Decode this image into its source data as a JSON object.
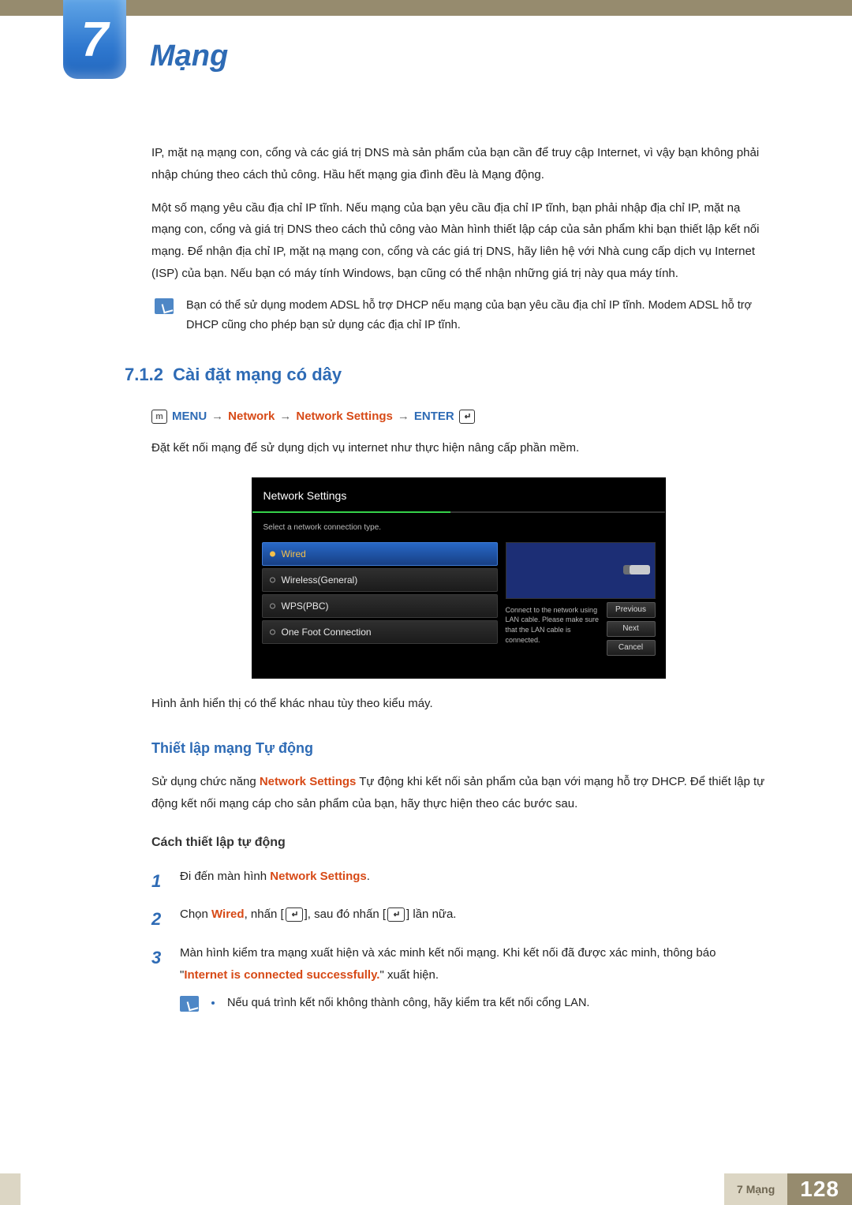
{
  "chapter": {
    "number": "7",
    "title": "Mạng"
  },
  "body": {
    "p1": "IP, mặt nạ mạng con, cổng và các giá trị DNS mà sản phẩm của bạn cần để truy cập Internet, vì vậy bạn không phải nhập chúng theo cách thủ công. Hầu hết mạng gia đình đều là Mạng động.",
    "p2": "Một số mạng yêu cầu địa chỉ IP tĩnh. Nếu mạng của bạn yêu cầu địa chỉ IP tĩnh, bạn phải nhập địa chỉ IP, mặt nạ mạng con, cổng và giá trị DNS theo cách thủ công vào Màn hình thiết lập cáp của sản phẩm khi bạn thiết lập kết nối mạng. Để nhận địa chỉ IP, mặt nạ mạng con, cổng và các giá trị DNS, hãy liên hệ với Nhà cung cấp dịch vụ Internet (ISP) của bạn. Nếu bạn có máy tính Windows, bạn cũng có thể nhận những giá trị này qua máy tính.",
    "note1": "Bạn có thể sử dụng modem ADSL hỗ trợ DHCP nếu mạng của bạn yêu cầu địa chỉ IP tĩnh. Modem ADSL hỗ trợ DHCP cũng cho phép bạn sử dụng các địa chỉ IP tĩnh."
  },
  "section": {
    "num": "7.1.2",
    "title": "Cài đặt mạng có dây"
  },
  "breadcrumb": {
    "menu": "MENU",
    "arrow": "→",
    "item1": "Network",
    "item2": "Network Settings",
    "enter": "ENTER"
  },
  "section_desc": "Đặt kết nối mạng để sử dụng dịch vụ internet như thực hiện nâng cấp phần mềm.",
  "ui": {
    "title": "Network Settings",
    "hint": "Select a network connection type.",
    "items": [
      "Wired",
      "Wireless(General)",
      "WPS(PBC)",
      "One Foot Connection"
    ],
    "description": "Connect to the network using LAN cable. Please make sure that the LAN cable is connected.",
    "buttons": [
      "Previous",
      "Next",
      "Cancel"
    ]
  },
  "caption": "Hình ảnh hiển thị có thể khác nhau tùy theo kiểu máy.",
  "auto": {
    "heading": "Thiết lập mạng Tự động",
    "p_pre": "Sử dụng chức năng ",
    "p_hl": "Network Settings",
    "p_post": " Tự động khi kết nối sản phẩm của bạn với mạng hỗ trợ DHCP. Để thiết lập tự động kết nối mạng cáp cho sản phẩm của bạn, hãy thực hiện theo các bước sau."
  },
  "howto": {
    "heading": "Cách thiết lập tự động",
    "step1_pre": "Đi đến màn hình ",
    "step1_hl": "Network Settings",
    "step1_post": ".",
    "step2_pre": "Chọn ",
    "step2_hl": "Wired",
    "step2_mid": ", nhấn [",
    "step2_mid2": "], sau đó nhấn [",
    "step2_post": "] lần nữa.",
    "step3_pre": "Màn hình kiểm tra mạng xuất hiện và xác minh kết nối mạng. Khi kết nối đã được xác minh, thông báo \"",
    "step3_hl": "Internet is connected successfully.",
    "step3_post": "\" xuất hiện.",
    "note": "Nếu quá trình kết nối không thành công, hãy kiểm tra kết nối cổng LAN."
  },
  "footer": {
    "label": "7 Mạng",
    "page": "128"
  }
}
